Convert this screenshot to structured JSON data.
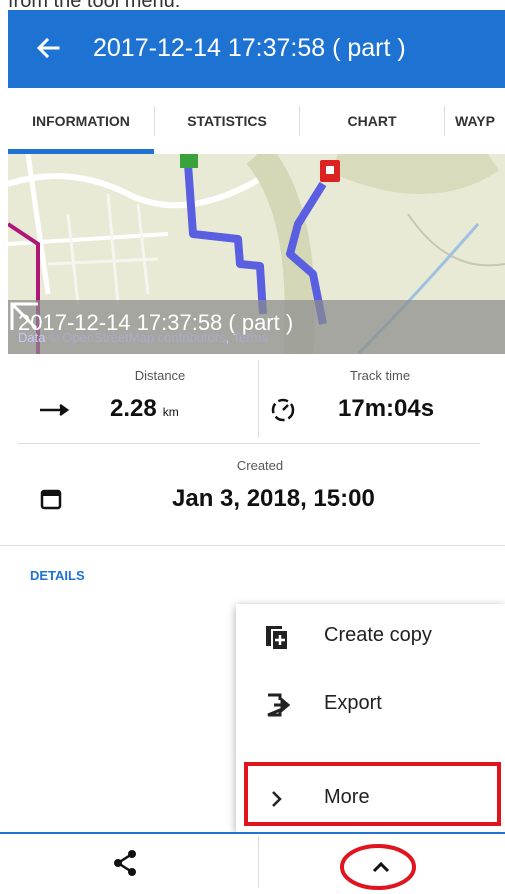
{
  "caption": "from the tool menu:",
  "appbar": {
    "title": "2017-12-14 17:37:58 ( part )",
    "back_icon": "arrow-left-icon"
  },
  "tabs": [
    {
      "label": "INFORMATION",
      "active": true
    },
    {
      "label": "STATISTICS",
      "active": false
    },
    {
      "label": "CHART",
      "active": false
    },
    {
      "label": "WAYP",
      "active": false
    }
  ],
  "map": {
    "track_name": "2017-12-14 17:37:58 ( part )",
    "attribution_prefix": "Data ",
    "attribution_link": "© OpenStreetMap contributors",
    "attribution_sep": ", ",
    "attribution_terms": "Terms"
  },
  "stats": {
    "distance_label": "Distance",
    "distance_value": "2.28",
    "distance_unit": "km",
    "track_time_label": "Track time",
    "track_time_value": "17m:04s",
    "created_label": "Created",
    "created_value": "Jan 3, 2018, 15:00"
  },
  "details_label": "DETAILS",
  "menu": {
    "items": [
      {
        "label": "Create copy",
        "icon": "copy-icon"
      },
      {
        "label": "Export",
        "icon": "export-icon"
      },
      {
        "label": "More",
        "icon": "chevron-right-icon"
      }
    ]
  },
  "bottombar": {
    "share_icon": "share-icon",
    "toggle_icon": "chevron-up-icon"
  },
  "colors": {
    "accent": "#1e73d2",
    "highlight": "#e0141e",
    "track": "#5a5ee0"
  }
}
